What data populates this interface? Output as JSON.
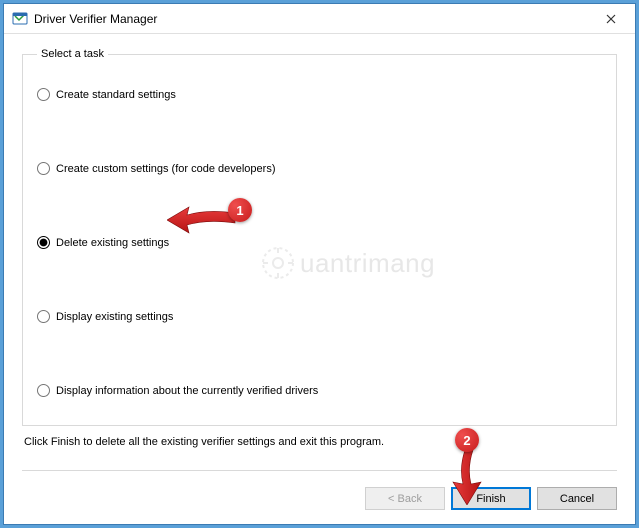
{
  "window": {
    "title": "Driver Verifier Manager"
  },
  "group": {
    "legend": "Select a task"
  },
  "options": {
    "create_standard": "Create standard settings",
    "create_custom": "Create custom settings (for code developers)",
    "delete_existing": "Delete existing settings",
    "display_existing": "Display existing settings",
    "display_info": "Display information about the currently verified drivers"
  },
  "instruction": "Click Finish to delete all the existing verifier settings and exit this program.",
  "buttons": {
    "back": "< Back",
    "finish": "Finish",
    "cancel": "Cancel"
  },
  "annotations": {
    "badge1": "1",
    "badge2": "2"
  },
  "watermark": {
    "text": "uantrimang"
  }
}
